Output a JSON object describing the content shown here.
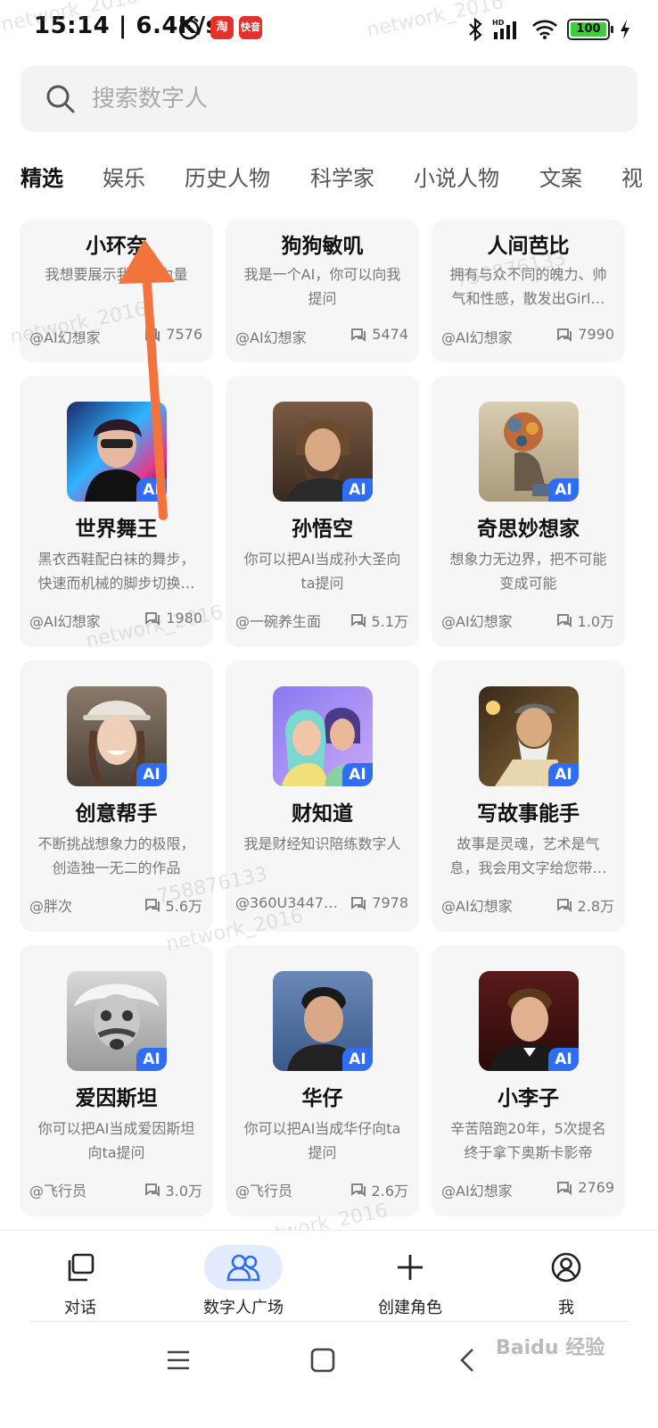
{
  "status_bar": {
    "time": "15:14",
    "net_speed": "6.4K/s",
    "app_icon_1": "淘",
    "app_icon_2": "快音",
    "battery": "100"
  },
  "search": {
    "placeholder": "搜索数字人"
  },
  "tabs": [
    "精选",
    "娱乐",
    "历史人物",
    "科学家",
    "小说人物",
    "文案",
    "视"
  ],
  "cards": [
    {
      "name": "小环奈",
      "desc": "我想要展示我的魅力量",
      "author": "@AI幻想家",
      "count": "7576"
    },
    {
      "name": "狗狗敏叽",
      "desc": "我是一个AI，你可以向我提问",
      "author": "@AI幻想家",
      "count": "5474"
    },
    {
      "name": "人间芭比",
      "desc": "拥有与众不同的魄力、帅气和性感，散发出Girl…",
      "author": "@AI幻想家",
      "count": "7990"
    },
    {
      "name": "世界舞王",
      "desc": "黑衣西鞋配白袜的舞步，快速而机械的脚步切换…",
      "author": "@AI幻想家",
      "count": "1980",
      "badge": "AI"
    },
    {
      "name": "孙悟空",
      "desc": "你可以把AI当成孙大圣向ta提问",
      "author": "@一碗养生面",
      "count": "5.1万",
      "badge": "AI"
    },
    {
      "name": "奇思妙想家",
      "desc": "想象力无边界，把不可能变成可能",
      "author": "@AI幻想家",
      "count": "1.0万",
      "badge": "AI"
    },
    {
      "name": "创意帮手",
      "desc": "不断挑战想象力的极限，创造独一无二的作品",
      "author": "@胖次",
      "count": "5.6万",
      "badge": "AI"
    },
    {
      "name": "财知道",
      "desc": "我是财经知识陪练数字人",
      "author": "@360U3447…",
      "count": "7978",
      "badge": "AI"
    },
    {
      "name": "写故事能手",
      "desc": "故事是灵魂，艺术是气息，我会用文字给您带…",
      "author": "@AI幻想家",
      "count": "2.8万",
      "badge": "AI"
    },
    {
      "name": "爱因斯坦",
      "desc": "你可以把AI当成爱因斯坦向ta提问",
      "author": "@飞行员",
      "count": "3.0万",
      "badge": "AI"
    },
    {
      "name": "华仔",
      "desc": "你可以把AI当成华仔向ta提问",
      "author": "@飞行员",
      "count": "2.6万",
      "badge": "AI"
    },
    {
      "name": "小李子",
      "desc": "辛苦陪跑20年，5次提名终于拿下奥斯卡影帝",
      "author": "@AI幻想家",
      "count": "2769",
      "badge": "AI"
    }
  ],
  "bottom_nav": [
    {
      "label": "对话",
      "icon": "chat-icon"
    },
    {
      "label": "数字人广场",
      "icon": "people-icon"
    },
    {
      "label": "创建角色",
      "icon": "plus-icon"
    },
    {
      "label": "我",
      "icon": "profile-icon"
    }
  ],
  "watermarks": [
    "network_2016",
    "758876133"
  ],
  "baidu": "Baidu 经验",
  "colors": {
    "accent": "#2f6df5",
    "active_nav_bg": "#e3ecfe",
    "arrow": "#f2743c"
  }
}
